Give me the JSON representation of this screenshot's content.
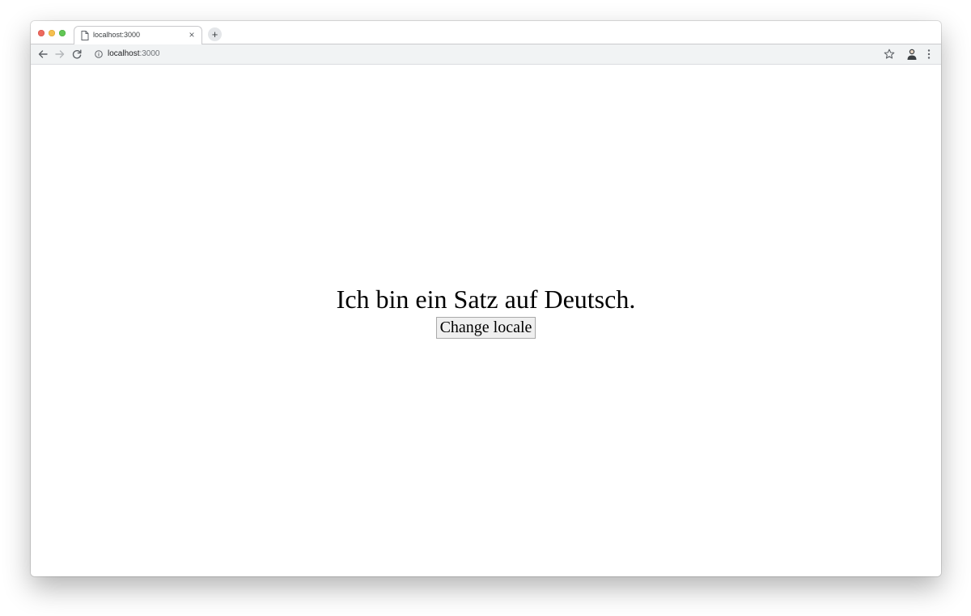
{
  "browser": {
    "tab": {
      "title": "localhost:3000",
      "close_glyph": "×"
    },
    "new_tab_glyph": "+",
    "address": {
      "host": "localhost",
      "port_suffix": ":3000"
    },
    "icons": {
      "back": "arrow-back-icon",
      "forward": "arrow-forward-icon",
      "reload": "reload-icon",
      "info": "info-icon",
      "star": "star-icon",
      "profile": "profile-icon",
      "menu": "kebab-menu-icon",
      "tab_page": "file-icon"
    },
    "colors": {
      "close": "#ed6a5e",
      "minimize": "#f5bf4f",
      "maximize": "#62c655"
    }
  },
  "page": {
    "sentence": "Ich bin ein Satz auf Deutsch.",
    "button_label": "Change locale"
  }
}
